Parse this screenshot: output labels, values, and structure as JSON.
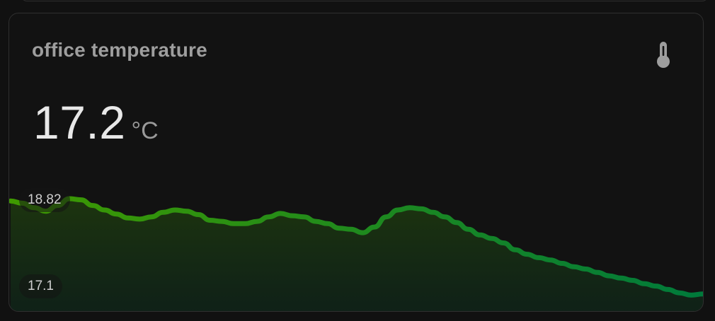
{
  "card": {
    "title": "office temperature",
    "icon": "thermometer-icon",
    "state": "17.2",
    "unit": "°C",
    "bounds": {
      "max": "18.82",
      "min": "17.1"
    }
  },
  "colors": {
    "background": "#111111",
    "card": "#121212",
    "line_start": "#3f9a00",
    "line_end": "#007a3b"
  },
  "chart_data": {
    "type": "line",
    "ylim": [
      17.1,
      18.82
    ],
    "series": [
      {
        "values": [
          18.78,
          18.74,
          18.66,
          18.6,
          18.7,
          18.82,
          18.8,
          18.7,
          18.62,
          18.55,
          18.48,
          18.46,
          18.5,
          18.58,
          18.62,
          18.6,
          18.54,
          18.44,
          18.42,
          18.38,
          18.38,
          18.42,
          18.5,
          18.56,
          18.52,
          18.5,
          18.42,
          18.38,
          18.3,
          18.28,
          18.22,
          18.32,
          18.5,
          18.62,
          18.66,
          18.64,
          18.58,
          18.5,
          18.4,
          18.28,
          18.18,
          18.12,
          18.04,
          17.92,
          17.84,
          17.78,
          17.74,
          17.68,
          17.62,
          17.58,
          17.52,
          17.46,
          17.42,
          17.38,
          17.32,
          17.28,
          17.22,
          17.16,
          17.12,
          17.14
        ]
      }
    ]
  }
}
